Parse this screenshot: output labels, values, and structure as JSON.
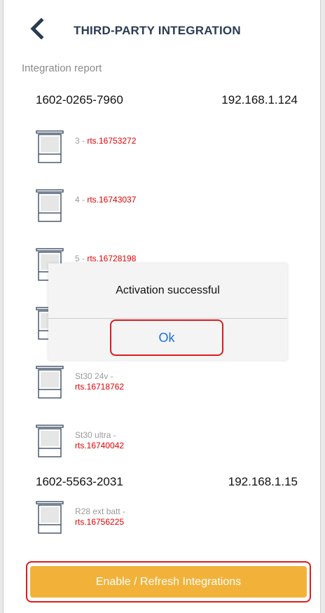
{
  "header": {
    "back_icon": "chevron-left-icon",
    "title": "THIRD-PARTY INTEGRATION"
  },
  "report_label": "Integration report",
  "gateways": [
    {
      "id": "1602-0265-7960",
      "ip": "192.168.1.124",
      "devices": [
        {
          "name": "3 - ",
          "code": "rts.16753272"
        },
        {
          "name": "4 - ",
          "code": "rts.16743037"
        },
        {
          "name": "5 - ",
          "code": "rts.16728198"
        },
        {
          "name": "",
          "code": ""
        },
        {
          "name": "St30 24v -",
          "code": "rts.16718762"
        },
        {
          "name": "St30 ultra -",
          "code": "rts.16740042"
        }
      ]
    },
    {
      "id": "1602-5563-2031",
      "ip": "192.168.1.15",
      "devices": [
        {
          "name": "R28 ext batt -",
          "code": "rts.16756225"
        }
      ]
    }
  ],
  "dialog": {
    "message": "Activation successful",
    "ok_label": "Ok"
  },
  "footer": {
    "refresh_label": "Enable / Refresh Integrations"
  },
  "colors": {
    "accent": "#f2b23a",
    "code_red": "#e00000",
    "link_blue": "#1a6fe0",
    "header_navy": "#2b3b52"
  }
}
